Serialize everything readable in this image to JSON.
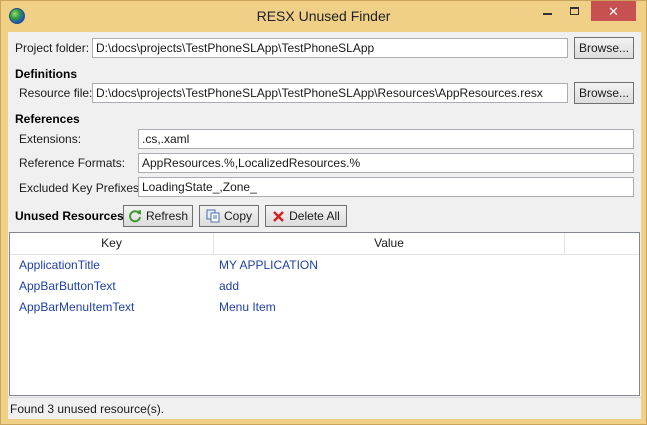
{
  "window": {
    "title": "RESX Unused Finder",
    "close_glyph": "✕",
    "frame_color": "#f0cf86",
    "close_color": "#c75050"
  },
  "project": {
    "label": "Project folder:",
    "value": "D:\\docs\\projects\\TestPhoneSLApp\\TestPhoneSLApp",
    "browse_label": "Browse..."
  },
  "definitions": {
    "heading": "Definitions",
    "resource_label": "Resource file:",
    "resource_value": "D:\\docs\\projects\\TestPhoneSLApp\\TestPhoneSLApp\\Resources\\AppResources.resx",
    "browse_label": "Browse..."
  },
  "references": {
    "heading": "References",
    "extensions_label": "Extensions:",
    "extensions_value": ".cs,.xaml",
    "formats_label": "Reference Formats:",
    "formats_value": "AppResources.%,LocalizedResources.%",
    "prefixes_label": "Excluded Key Prefixes:",
    "prefixes_value": "LoadingState_,Zone_"
  },
  "unused": {
    "heading": "Unused Resources",
    "refresh_label": "Refresh",
    "copy_label": "Copy",
    "delete_label": "Delete All",
    "columns": [
      "Key",
      "Value"
    ],
    "rows": [
      {
        "key": "ApplicationTitle",
        "value": "MY APPLICATION"
      },
      {
        "key": "AppBarButtonText",
        "value": "add"
      },
      {
        "key": "AppBarMenuItemText",
        "value": "Menu Item"
      }
    ],
    "row_text_color": "#1f3fa6"
  },
  "status": {
    "text": "Found 3 unused resource(s)."
  },
  "icons": {
    "app": "globe-icon",
    "refresh": "refresh-icon",
    "copy": "copy-icon",
    "delete": "delete-icon"
  }
}
